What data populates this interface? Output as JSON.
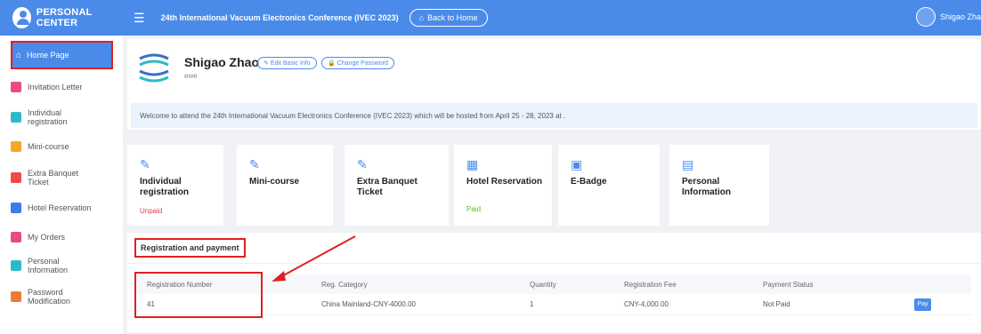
{
  "topbar": {
    "brand": "PERSONAL CENTER",
    "menu_icon": "menu-icon",
    "conference_title": "24th International Vacuum Electronics Conference (IVEC 2023)",
    "back_button": "Back to Home",
    "user_name": "Shigao Zha"
  },
  "sidebar": {
    "items": [
      {
        "label": "Home Page",
        "icon": "home-icon"
      },
      {
        "label": "Invitation Letter",
        "icon": "letter-icon"
      },
      {
        "label": "Individual registration",
        "icon": "registration-icon"
      },
      {
        "label": "Mini-course",
        "icon": "course-icon"
      },
      {
        "label": "Extra Banquet Ticket",
        "icon": "ticket-icon"
      },
      {
        "label": "Hotel Reservation",
        "icon": "hotel-icon"
      },
      {
        "label": "My Orders",
        "icon": "orders-icon"
      },
      {
        "label": "Personal Information",
        "icon": "info-icon"
      },
      {
        "label": "Password Modification",
        "icon": "password-icon"
      }
    ]
  },
  "profile": {
    "name": "Shigao Zhao",
    "subtitle": "ewe",
    "edit_button": "Edit Basic Info",
    "password_button": "Change Password",
    "welcome": "Welcome to attend the 24th International Vacuum Electronics Conference (IVEC 2023) which will be hosted from April 25 - 28, 2023 at ."
  },
  "tiles": [
    {
      "name": "Individual registration",
      "status": "Unpaid",
      "status_color": "#e04040",
      "icon": "edit-icon"
    },
    {
      "name": "Mini-course",
      "status": "",
      "status_color": "#333333",
      "icon": "edit-icon"
    },
    {
      "name": "Extra Banquet Ticket",
      "status": "",
      "status_color": "#333333",
      "icon": "edit-icon"
    },
    {
      "name": "Hotel Reservation",
      "status": "Paid",
      "status_color": "#52c41a",
      "icon": "building-icon"
    },
    {
      "name": "E-Badge",
      "status": "",
      "status_color": "#333333",
      "icon": "badge-icon"
    },
    {
      "name": "Personal Information",
      "status": "",
      "status_color": "#333333",
      "icon": "document-icon"
    }
  ],
  "registration": {
    "title": "Registration and payment",
    "headers": [
      "Registration Number",
      "Reg. Category",
      "Quantity",
      "Registration Fee",
      "Payment Status",
      ""
    ],
    "rows": [
      [
        "41",
        "China Mainland-CNY-4000.00",
        "1",
        "CNY-4,000.00",
        "Not Paid",
        "Pay"
      ]
    ]
  },
  "colors": {
    "accent": "#4a8bea",
    "highlight": "#e02020"
  }
}
